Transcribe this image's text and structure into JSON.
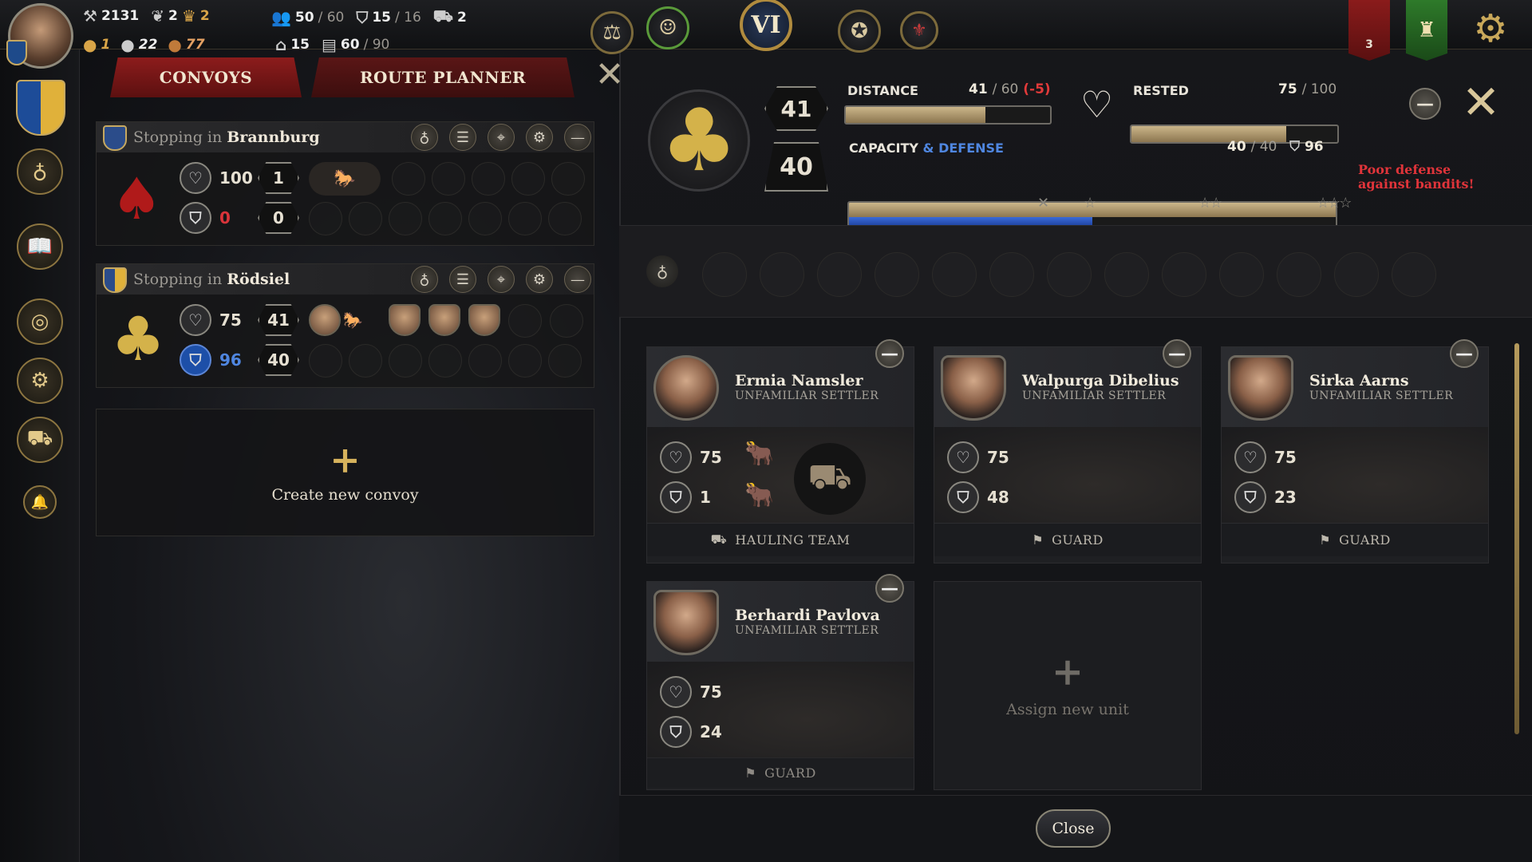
{
  "topbar": {
    "resources_row1": [
      {
        "icon": "hammer-icon",
        "value": "2131"
      },
      {
        "icon": "laurel-icon",
        "value": "2"
      },
      {
        "icon": "crown-coin-icon",
        "value": "2"
      },
      {
        "icon": "people-icon",
        "value": "50",
        "max": "/ 60"
      },
      {
        "icon": "shield-coin-icon",
        "value": "15",
        "max": "/ 16"
      },
      {
        "icon": "cart-icon",
        "value": "2"
      }
    ],
    "resources_row2": [
      {
        "icon": "gold-coin-icon",
        "value": "1"
      },
      {
        "icon": "silver-coin-icon",
        "value": "22"
      },
      {
        "icon": "copper-coin-icon",
        "value": "77"
      },
      {
        "icon": "house-icon",
        "value": "15"
      },
      {
        "icon": "storage-icon",
        "value": "60",
        "max": "/ 90"
      }
    ],
    "era": "VI",
    "notification_count": "3"
  },
  "tabs": {
    "convoys": "CONVOYS",
    "route_planner": "ROUTE PLANNER"
  },
  "convoys": [
    {
      "stopping_prefix": "Stopping in",
      "town": "Brannburg",
      "suit": "♠",
      "suit_color": "#b01a1a",
      "health": "100",
      "defense": "0",
      "capacity": "1",
      "capacity2": "0"
    },
    {
      "stopping_prefix": "Stopping in",
      "town": "Rödsiel",
      "suit": "♣",
      "suit_color": "#d4b24a",
      "health": "75",
      "defense": "96",
      "capacity": "41",
      "capacity2": "40"
    }
  ],
  "create_convoy": "Create new convoy",
  "detail": {
    "capacity_top": "41",
    "capacity_bottom": "40",
    "distance_label": "DISTANCE",
    "distance_value": "41",
    "distance_max": "/ 60",
    "distance_delta": "(-5)",
    "distance_fraction": 0.683,
    "rested_label": "RESTED",
    "rested_value": "75",
    "rested_max": "/ 100",
    "rested_fraction": 0.75,
    "capacity_label": "CAPACITY",
    "defense_label": "& DEFENSE",
    "capacity_value": "40",
    "capacity_max": "/ 40",
    "defense_value": "96",
    "capacity_fraction": 1.0,
    "defense_fraction": 0.5,
    "warning": "Poor defense against bandits!"
  },
  "units": [
    {
      "name": "Ermia Namsler",
      "role": "UNFAMILIAR SETTLER",
      "health": "75",
      "defense": "1",
      "job": "HAULING TEAM",
      "job_icon": "cart-icon"
    },
    {
      "name": "Walpurga Dibelius",
      "role": "UNFAMILIAR SETTLER",
      "health": "75",
      "defense": "48",
      "job": "GUARD",
      "job_icon": "flag-icon"
    },
    {
      "name": "Sirka Aarns",
      "role": "UNFAMILIAR SETTLER",
      "health": "75",
      "defense": "23",
      "job": "GUARD",
      "job_icon": "flag-icon"
    },
    {
      "name": "Berhardi Pavlova",
      "role": "UNFAMILIAR SETTLER",
      "health": "75",
      "defense": "24",
      "job": "GUARD",
      "job_icon": "flag-icon"
    }
  ],
  "assign_unit": "Assign new unit",
  "close_button": "Close"
}
